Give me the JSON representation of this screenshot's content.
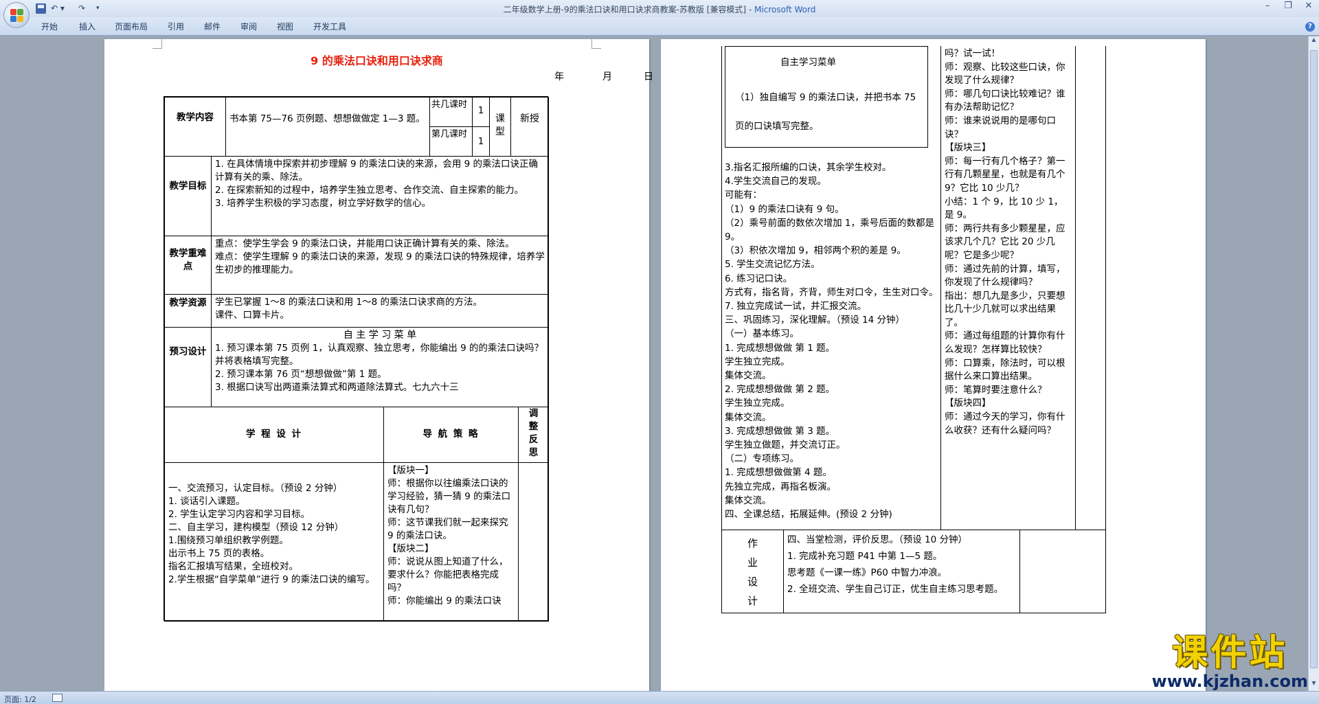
{
  "window": {
    "title_doc": "二年级数学上册-9的乘法口诀和用口诀求商教案-苏教版 [兼容模式] - ",
    "title_app": "Microsoft Word",
    "ribbon_tabs": [
      "开始",
      "插入",
      "页面布局",
      "引用",
      "邮件",
      "审阅",
      "视图",
      "开发工具"
    ]
  },
  "status": {
    "page": "页面: 1/2"
  },
  "watermark": {
    "title": "课件站",
    "url": "www.kjzhan.com"
  },
  "page1": {
    "title": "9 的乘法口诀和用口诀求商",
    "date": {
      "year": "年",
      "month": "月",
      "day": "日"
    },
    "content_label": "教学内容",
    "content_text": "书本第 75—76 页例题、想想做做定 1—3 题。",
    "total_label": "共几课时",
    "total_value": "1",
    "which_label": "第几课时",
    "which_value": "1",
    "type_label": "课型",
    "type_value": "新授",
    "goals_label": "教学目标",
    "goals": [
      "1. 在具体情境中探索并初步理解 9 的乘法口诀的来源，会用 9 的乘法口诀正确计算有关的乘、除法。",
      "2. 在探索新知的过程中，培养学生独立思考、合作交流、自主探索的能力。",
      "3. 培养学生积极的学习态度，树立学好数学的信心。"
    ],
    "key_label": "教学重难点",
    "key_points": [
      "重点：使学生学会 9 的乘法口诀，并能用口诀正确计算有关的乘、除法。",
      "难点：使学生理解 9 的乘法口诀的来源，发现 9 的乘法口诀的特殊规律，培养学生初步的推理能力。"
    ],
    "res_label": "教学资源",
    "resources": [
      "学生已掌握 1～8 的乘法口诀和用 1～8 的乘法口诀求商的方法。",
      "课件、口算卡片。"
    ],
    "pre_label": "预习设计",
    "pre_menu_title": "自 主 学 习 菜 单",
    "pre_items": [
      "1. 预习课本第 75 页例 1，认真观察、独立思考，你能编出 9 的的乘法口诀吗？并将表格填写完整。",
      "2. 预习课本第 76 页“想想做做”第 1 题。",
      "3. 根据口诀写出两道乘法算式和两道除法算式。七九六十三"
    ],
    "col1_head": "学 程 设 计",
    "col2_head": "导 航 策 略",
    "col3_head": "调整反思",
    "col1_lines": [
      "一、交流预习，认定目标。（预设 2 分钟）",
      "1. 谈话引入课题。",
      "2. 学生认定学习内容和学习目标。",
      "二、自主学习，建构模型（预设 12 分钟）",
      "1.围绕预习单组织教学例题。",
      "出示书上 75 页的表格。",
      "指名汇报填写结果，全班校对。",
      "2.学生根据“自学菜单”进行 9 的乘法口诀的编写。"
    ],
    "col2_lines": [
      "【版块一】",
      "师：根据你以往编乘法口诀的学习经验，猜一猜 9 的乘法口诀有几句？",
      "师：这节课我们就一起来探究 9 的乘法口诀。",
      "【版块二】",
      "师：说说从图上知道了什么，要求什么？你能把表格完成吗？",
      "师：你能编出 9 的乘法口诀"
    ]
  },
  "page2": {
    "menu_title": "自主学习菜单",
    "menu_item": "（1）独自编写 9 的乘法口诀，并把书本 75 页的口诀填写完整。",
    "left_lines": [
      "3.指名汇报所编的口诀，其余学生校对。",
      "4.学生交流自己的发现。",
      "可能有：",
      "（1）9 的乘法口诀有 9 句。",
      "（2）乘号前面的数依次增加 1，乘号后面的数都是 9。",
      "（3）积依次增加 9，相邻两个积的差是 9。",
      "5. 学生交流记忆方法。",
      "6. 练习记口诀。",
      "方式有，指名背，齐背，师生对口令，生生对口令。",
      "7. 独立完成试一试，并汇报交流。",
      "三、巩固练习，深化理解。（预设 14 分钟）",
      "（一）基本练习。",
      "1. 完成想想做做 第 1 题。",
      "学生独立完成。",
      "集体交流。",
      "2. 完成想想做做 第 2 题。",
      "学生独立完成。",
      "集体交流。",
      "3. 完成想想做做 第 3 题。",
      "学生独立做题，并交流订正。",
      "（二）专项练习。",
      "1. 完成想想做做第 4 题。",
      "先独立完成，再指名板演。",
      "集体交流。",
      "四、全课总结，拓展延伸。(预设 2 分钟)"
    ],
    "right_lines": [
      "吗？试一试！",
      "师：观察、比较这些口诀，你发现了什么规律？",
      "师：哪几句口诀比较难记？谁有办法帮助记忆？",
      "师：谁来说说用的是哪句口诀？",
      "【版块三】",
      "师：每一行有几个格子？第一行有几颗星星，也就是有几个 9？它比 10 少几？",
      "小结：1 个 9，比 10 少 1，是 9。",
      "师：两行共有多少颗星星，应该求几个几？它比 20 少几呢？它是多少呢？",
      "师：通过先前的计算，填写，你发现了什么规律吗？",
      "指出：想几九是多少，只要想比几十少几就可以求出结果了。",
      "师：通过每组题的计算你有什么发现？怎样算比较快？",
      "师：口算乘，除法时，可以根据什么来口算出结果。",
      "师：笔算时要注意什么？",
      "【版块四】",
      "师：通过今天的学习，你有什么收获？还有什么疑问吗？"
    ],
    "homework_label": "作业设计",
    "homework_lines": [
      "四、当堂检测，评价反思。（预设 10 分钟）",
      "1. 完成补充习题 P41 中第 1—5 题。",
      "思考题《一课一练》P60 中智力冲浪。",
      "2. 全班交流、学生自己订正，优生自主练习思考题。"
    ]
  }
}
